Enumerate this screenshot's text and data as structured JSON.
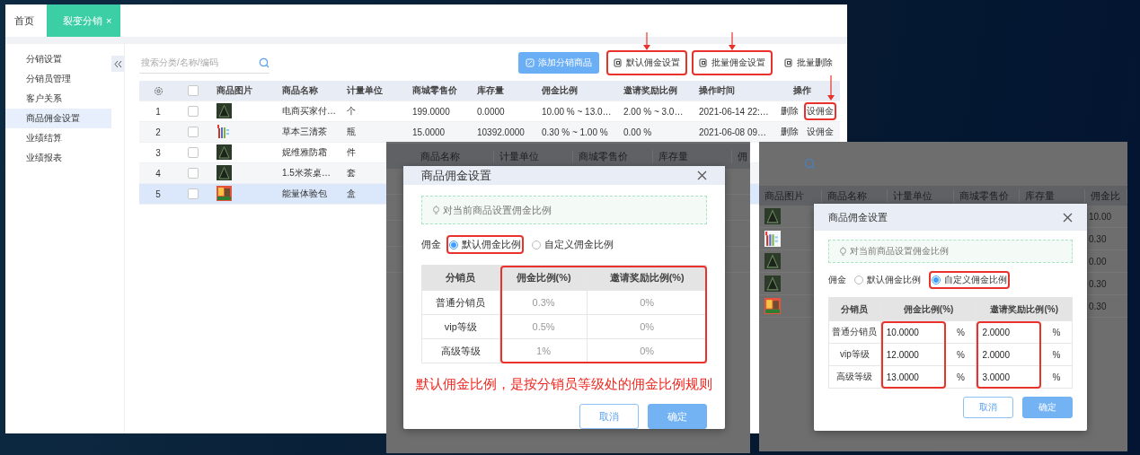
{
  "main_window": {
    "tabs": [
      {
        "label": "首页",
        "selected": false,
        "closable": false
      },
      {
        "label": "裂变分销",
        "selected": true,
        "closable": true,
        "close_icon": "×"
      }
    ],
    "sidebar": {
      "items": [
        {
          "label": "分销设置",
          "selected": false
        },
        {
          "label": "分销员管理",
          "selected": false
        },
        {
          "label": "客户关系",
          "selected": false
        },
        {
          "label": "商品佣金设置",
          "selected": true
        },
        {
          "label": "业绩结算",
          "selected": false
        },
        {
          "label": "业绩报表",
          "selected": false
        }
      ]
    },
    "search": {
      "placeholder": "搜索分类/名称/编码"
    },
    "toolbar": [
      {
        "label": "添加分销商品",
        "kind": "primary",
        "highlighted": false
      },
      {
        "label": "默认佣金设置",
        "kind": "plain",
        "highlighted": true
      },
      {
        "label": "批量佣金设置",
        "kind": "plain",
        "highlighted": true
      },
      {
        "label": "批量删除",
        "kind": "plain",
        "highlighted": false
      }
    ],
    "table": {
      "header_checked": false,
      "image_column": "商品图片",
      "columns": [
        "商品名称",
        "计量单位",
        "商城零售价",
        "库存量",
        "佣金比例",
        "邀请奖励比例",
        "操作时间",
        "操作"
      ],
      "rows": [
        {
          "index": "1",
          "checked": false,
          "selected": false,
          "thumbnail": {
            "kind": "letter"
          },
          "cells": [
            "电商买家付…",
            "个",
            "199.0000",
            "0.0000",
            "10.00 % ~ 13.0…",
            "2.00 % ~ 3.0…",
            "2021-06-14 22:…"
          ],
          "actions": [
            {
              "label": "删除",
              "highlighted": false
            },
            {
              "label": "设佣金",
              "highlighted": true
            }
          ]
        },
        {
          "index": "2",
          "checked": false,
          "selected": false,
          "thumbnail": {
            "kind": "bottles"
          },
          "cells": [
            "草本三清茶",
            "瓶",
            "15.0000",
            "10392.0000",
            "0.30 % ~ 1.00 %",
            "0.00 %",
            "2021-06-08 09…"
          ],
          "actions": [
            {
              "label": "删除",
              "highlighted": false
            },
            {
              "label": "设佣金",
              "highlighted": false
            }
          ]
        },
        {
          "index": "3",
          "checked": false,
          "selected": false,
          "thumbnail": {
            "kind": "letter"
          },
          "cells": [
            "妮维雅防霜",
            "件"
          ]
        },
        {
          "index": "4",
          "checked": false,
          "selected": false,
          "thumbnail": {
            "kind": "letter"
          },
          "cells": [
            "1.5米茶桌…",
            "套"
          ]
        },
        {
          "index": "5",
          "checked": false,
          "selected": true,
          "thumbnail": {
            "kind": "package"
          },
          "cells": [
            "能量体验包",
            "盒"
          ]
        }
      ]
    }
  },
  "default_mode_panel": {
    "backdrop_columns": [
      "商品名称",
      "计量单位",
      "商城零售价",
      "库存量",
      "佣"
    ],
    "dialog": {
      "title": "商品佣金设置",
      "tip": "对当前商品设置佣金比例",
      "radio_label": "佣金",
      "options": [
        {
          "label": "默认佣金比例",
          "selected": true,
          "highlighted": true
        },
        {
          "label": "自定义佣金比例",
          "selected": false,
          "highlighted": false
        }
      ],
      "columns": [
        {
          "label": "分销员",
          "highlighted": false
        },
        {
          "label": "佣金比例(%)",
          "highlighted": true
        },
        {
          "label": "邀请奖励比例(%)",
          "highlighted": true
        }
      ],
      "rows": [
        {
          "grade": "普通分销员",
          "values": [
            {
              "kind": "text",
              "value": "0.3%"
            },
            {
              "kind": "text",
              "value": "0%"
            }
          ]
        },
        {
          "grade": "vip等级",
          "values": [
            {
              "kind": "text",
              "value": "0.5%"
            },
            {
              "kind": "text",
              "value": "0%"
            }
          ]
        },
        {
          "grade": "高级等级",
          "values": [
            {
              "kind": "text",
              "value": "1%"
            },
            {
              "kind": "text",
              "value": "0%"
            }
          ]
        }
      ],
      "note": "默认佣金比例，是按分销员等级处的佣金比例规则",
      "buttons": [
        {
          "label": "取消",
          "kind": "secondary"
        },
        {
          "label": "确定",
          "kind": "primary"
        }
      ]
    }
  },
  "custom_mode_panel": {
    "backdrop_columns": [
      "商品图片",
      "商品名称",
      "计量单位",
      "商城零售价",
      "库存量",
      "佣金比"
    ],
    "backdrop_rows": [
      {
        "thumbnail": {
          "kind": "letter"
        },
        "commission": "10.00"
      },
      {
        "thumbnail": {
          "kind": "bottles"
        },
        "commission": "0.30"
      },
      {
        "thumbnail": {
          "kind": "letter"
        },
        "commission": "0.00"
      },
      {
        "thumbnail": {
          "kind": "letter"
        },
        "commission": "0.30"
      },
      {
        "thumbnail": {
          "kind": "package"
        },
        "commission": "0.30"
      }
    ],
    "dialog": {
      "title": "商品佣金设置",
      "tip": "对当前商品设置佣金比例",
      "radio_label": "佣金",
      "options": [
        {
          "label": "默认佣金比例",
          "selected": false,
          "highlighted": false
        },
        {
          "label": "自定义佣金比例",
          "selected": true,
          "highlighted": true
        }
      ],
      "columns": [
        {
          "label": "分销员",
          "highlighted": false
        },
        {
          "label": "佣金比例(%)",
          "highlighted": true
        },
        {
          "label": "邀请奖励比例(%)",
          "highlighted": true
        }
      ],
      "rows": [
        {
          "grade": "普通分销员",
          "values": [
            {
              "kind": "input",
              "value": "10.0000",
              "unit": "%"
            },
            {
              "kind": "input",
              "value": "2.0000",
              "unit": "%"
            }
          ]
        },
        {
          "grade": "vip等级",
          "values": [
            {
              "kind": "input",
              "value": "12.0000",
              "unit": "%"
            },
            {
              "kind": "input",
              "value": "2.0000",
              "unit": "%"
            }
          ]
        },
        {
          "grade": "高级等级",
          "values": [
            {
              "kind": "input",
              "value": "13.0000",
              "unit": "%"
            },
            {
              "kind": "input",
              "value": "3.0000",
              "unit": "%"
            }
          ]
        }
      ],
      "buttons": [
        {
          "label": "取消",
          "kind": "secondary"
        },
        {
          "label": "确定",
          "kind": "primary"
        }
      ]
    }
  }
}
